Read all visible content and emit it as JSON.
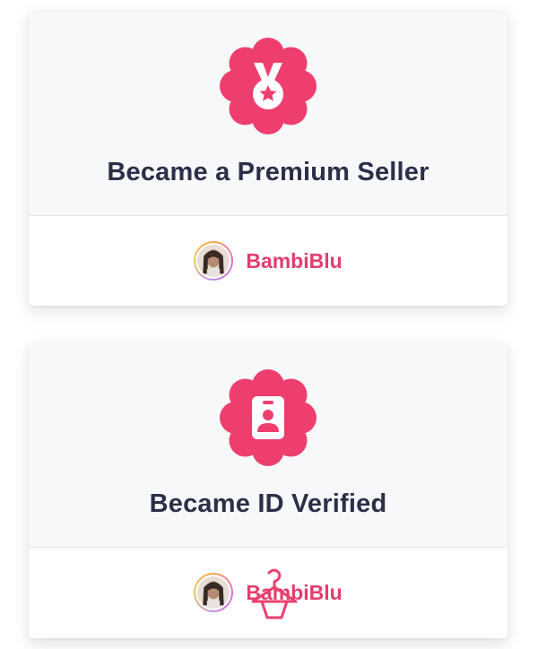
{
  "colors": {
    "accent": "#ee3e6e",
    "title": "#2c2f48",
    "username": "#e13d6e",
    "card_top_bg": "#f7f8fa"
  },
  "cards": [
    {
      "badge_icon": "medal-star-icon",
      "title": "Became a Premium Seller",
      "user": {
        "name": "BambiBlu",
        "avatar": "user-avatar"
      }
    },
    {
      "badge_icon": "id-badge-icon",
      "title": "Became ID Verified",
      "user": {
        "name": "BambiBlu",
        "avatar": "user-avatar"
      }
    }
  ]
}
